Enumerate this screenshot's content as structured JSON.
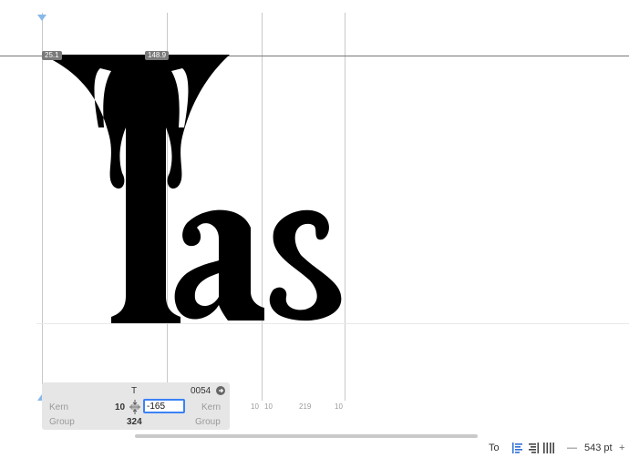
{
  "canvas": {
    "glyph_text": "Tas",
    "labels": {
      "left_sidebearing_T": "25.1",
      "advance_T": "148.9"
    },
    "metrics": {
      "m1": "10",
      "m2": "10",
      "m3": "219",
      "m4": "10"
    }
  },
  "info_panel": {
    "glyph_name": "T",
    "unicode": "0054",
    "kern_left_label": "Kern",
    "kern_left_value": "10",
    "kern_right_value": "-165",
    "kern_right_label": "Kern",
    "group_left_label": "Group",
    "group_right_label": "Group",
    "width_value": "324"
  },
  "bottom_bar": {
    "text_input": "To",
    "zoom": "543 pt",
    "zoom_out": "—",
    "zoom_in": "+"
  },
  "icons": [
    "align-left-icon",
    "align-right-icon",
    "columns-icon",
    "arrow-right-circle-icon",
    "kern-lock-icon"
  ],
  "colors": {
    "accent": "#3b82f6",
    "glyph": "#000000",
    "guide": "#bfbfbf",
    "panel": "#e6e6e6"
  }
}
